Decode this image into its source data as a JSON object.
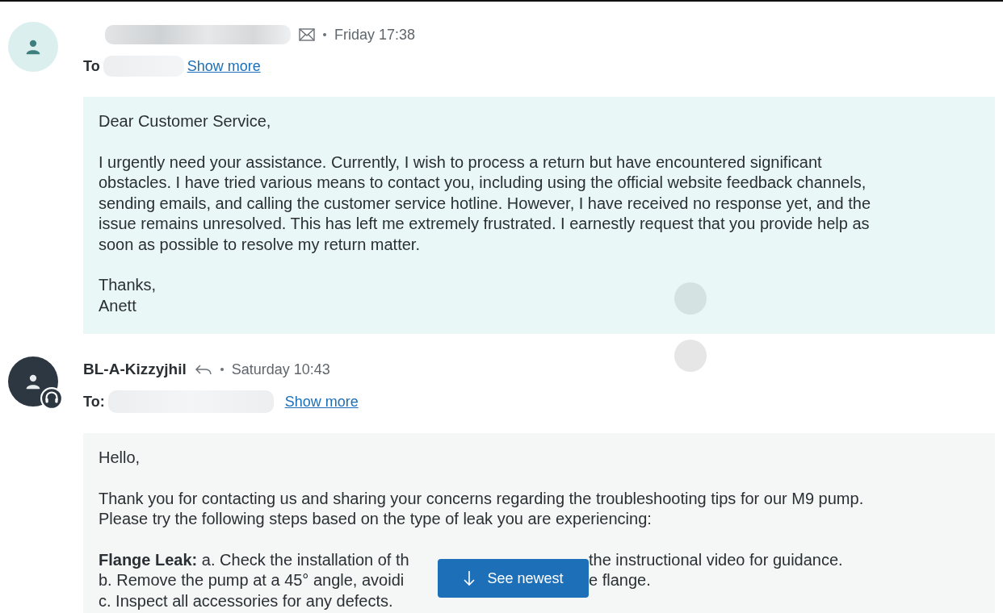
{
  "messages": [
    {
      "kind": "customer",
      "time": "Friday 17:38",
      "to_label": "To",
      "show_more": "Show more",
      "paragraphs": [
        {
          "lines": [
            "Dear Customer Service,"
          ]
        },
        {
          "lines": [
            "I urgently need your assistance. Currently, I wish to process a return but have encountered significant",
            "obstacles. I have tried various means to contact you, including using the official website feedback channels,",
            "sending emails, and calling the customer service hotline. However, I have received no response yet, and the",
            "issue remains unresolved. This has left me extremely frustrated. I earnestly request that you provide help as",
            "soon as possible to resolve my return matter."
          ]
        },
        {
          "lines": [
            "Thanks,",
            "Anett"
          ]
        }
      ]
    },
    {
      "kind": "agent",
      "sender": "BL-A-Kizzyjhil",
      "time": "Saturday 10:43",
      "to_label": "To:",
      "show_more": "Show more",
      "paragraphs": [
        {
          "lines": [
            "Hello,"
          ]
        },
        {
          "lines": [
            "Thank you for contacting us and sharing your concerns regarding the troubleshooting tips for our M9 pump.",
            "Please try the following steps based on the type of leak you are experiencing:"
          ]
        },
        {
          "rows": [
            {
              "left": "**Flange Leak:** a. Check the installation of th",
              "right": "the instructional video for guidance."
            },
            {
              "left": "b. Remove the pump at a 45° angle, avoidi",
              "right": "e flange."
            },
            {
              "left": "c. Inspect all accessories for any defects."
            }
          ]
        }
      ]
    }
  ],
  "see_newest": {
    "label": "See newest"
  }
}
